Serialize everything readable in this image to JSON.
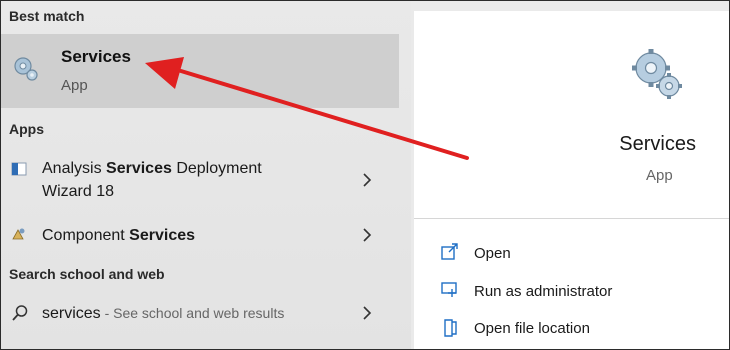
{
  "sections": {
    "best_match": "Best match",
    "apps": "Apps",
    "search_web": "Search school and web"
  },
  "best_match": {
    "title": "Services",
    "subtitle": "App",
    "icon": "gears-icon"
  },
  "apps": [
    {
      "prefix": "Analysis ",
      "bold": "Services",
      "suffix": " Deployment",
      "line2": "Wizard 18",
      "icon": "analysis-services-icon"
    },
    {
      "prefix": "Component ",
      "bold": "Services",
      "suffix": "",
      "icon": "component-services-icon"
    }
  ],
  "web_search": {
    "query": "services",
    "hint": " - See school and web results",
    "icon": "search-icon"
  },
  "details": {
    "title": "Services",
    "subtitle": "App",
    "actions": [
      {
        "label": "Open",
        "icon": "open-icon"
      },
      {
        "label": "Run as administrator",
        "icon": "shield-icon"
      },
      {
        "label": "Open file location",
        "icon": "folder-icon"
      }
    ]
  },
  "annotation": {
    "color": "#e02020"
  }
}
